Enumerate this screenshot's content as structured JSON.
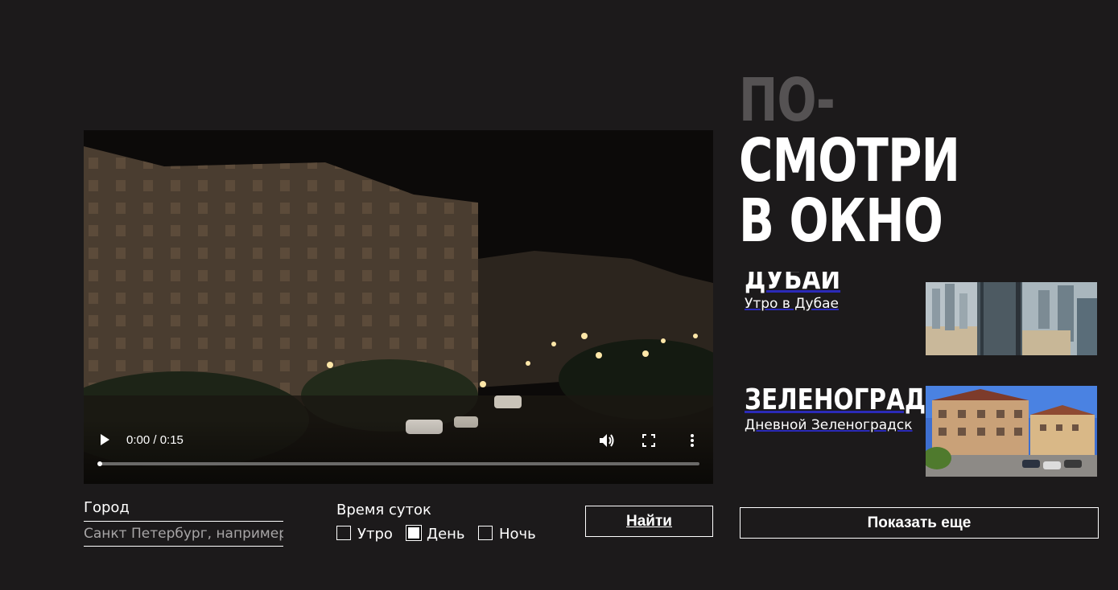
{
  "hero": {
    "title_line1": "ПО-",
    "title_line2": "СМОТРИ",
    "title_line3": "В ОКНО"
  },
  "video": {
    "time": "0:00 / 0:15",
    "progress": 0
  },
  "cards": [
    {
      "title": "ДУБАЙ",
      "subtitle": "Утро в Дубае"
    },
    {
      "title": "ЗЕЛЕНОГРАДСК",
      "subtitle": "Дневной Зеленоградск"
    }
  ],
  "search": {
    "city_label": "Город",
    "city_placeholder": "Санкт Петербург, например",
    "time_label": "Время суток",
    "options": [
      {
        "label": "Утро",
        "checked": false
      },
      {
        "label": "День",
        "checked": true
      },
      {
        "label": "Ночь",
        "checked": false
      }
    ],
    "find_label": "Найти"
  },
  "show_more_label": "Показать еще"
}
